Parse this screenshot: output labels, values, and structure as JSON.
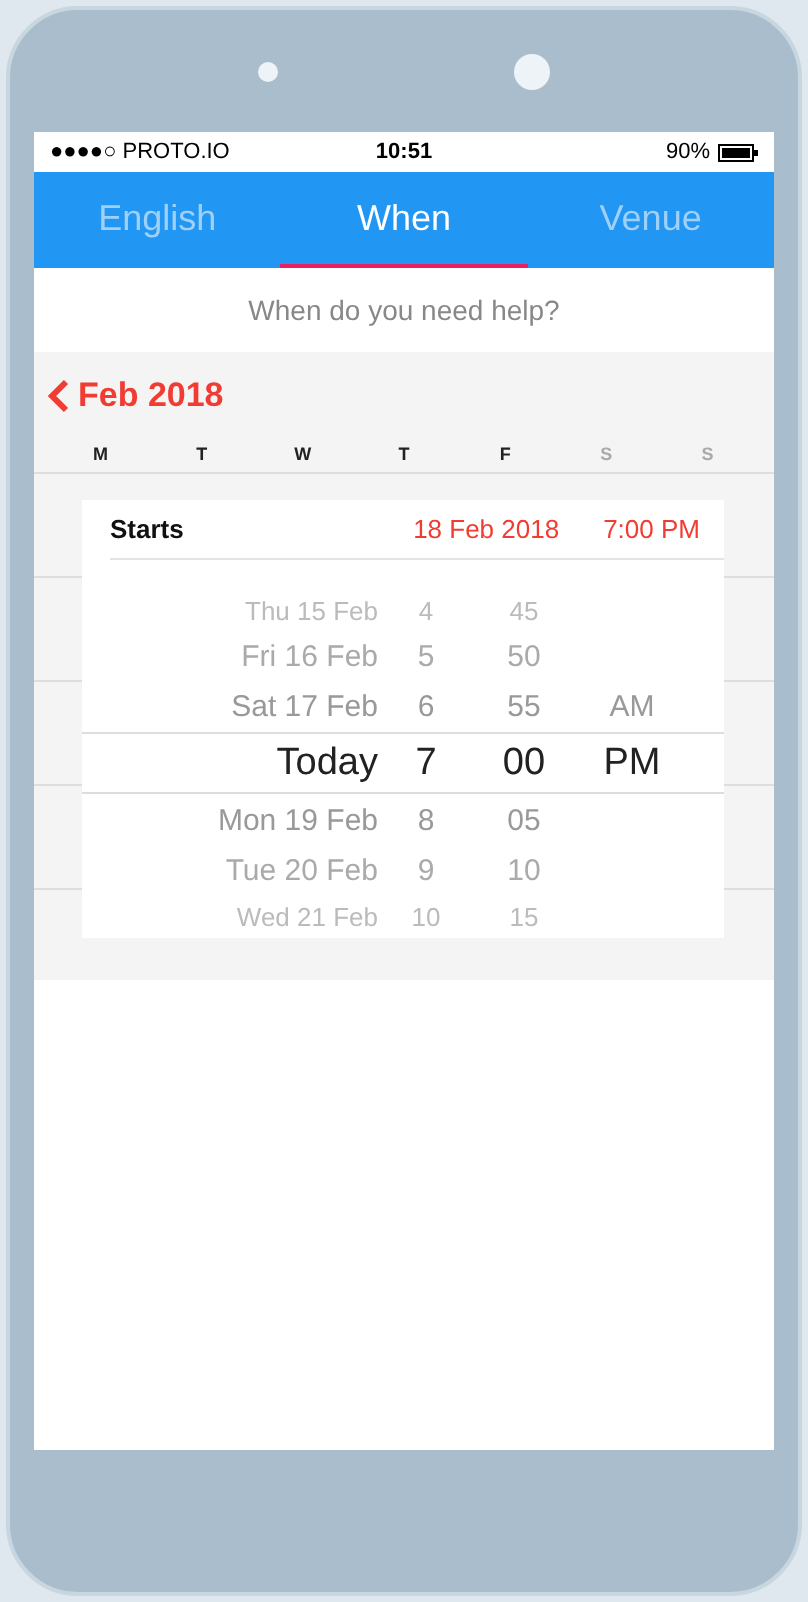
{
  "status_bar": {
    "carrier": "●●●●○ PROTO.IO",
    "time": "10:51",
    "battery": "90%"
  },
  "tabs": [
    {
      "label": "English",
      "selected": false
    },
    {
      "label": "When",
      "selected": true
    },
    {
      "label": "Venue",
      "selected": false
    }
  ],
  "prompt": "When do you need help?",
  "calendar": {
    "month": "Feb 2018",
    "weekdays": [
      {
        "label": "M",
        "weekend": false
      },
      {
        "label": "T",
        "weekend": false
      },
      {
        "label": "W",
        "weekend": false
      },
      {
        "label": "T",
        "weekend": false
      },
      {
        "label": "F",
        "weekend": false
      },
      {
        "label": "S",
        "weekend": true
      },
      {
        "label": "S",
        "weekend": true
      }
    ]
  },
  "picker": {
    "label": "Starts",
    "date": "18 Feb 2018",
    "time": "7:00 PM",
    "rows": [
      {
        "date": "Thu 15 Feb",
        "hour": "4",
        "minute": "45",
        "period": "",
        "selected": false
      },
      {
        "date": "Fri 16 Feb",
        "hour": "5",
        "minute": "50",
        "period": "",
        "selected": false
      },
      {
        "date": "Sat 17 Feb",
        "hour": "6",
        "minute": "55",
        "period": "AM",
        "selected": false
      },
      {
        "date": "Today",
        "hour": "7",
        "minute": "00",
        "period": "PM",
        "selected": true
      },
      {
        "date": "Mon 19 Feb",
        "hour": "8",
        "minute": "05",
        "period": "",
        "selected": false
      },
      {
        "date": "Tue 20 Feb",
        "hour": "9",
        "minute": "10",
        "period": "",
        "selected": false
      },
      {
        "date": "Wed 21 Feb",
        "hour": "10",
        "minute": "15",
        "period": "",
        "selected": false
      }
    ]
  }
}
